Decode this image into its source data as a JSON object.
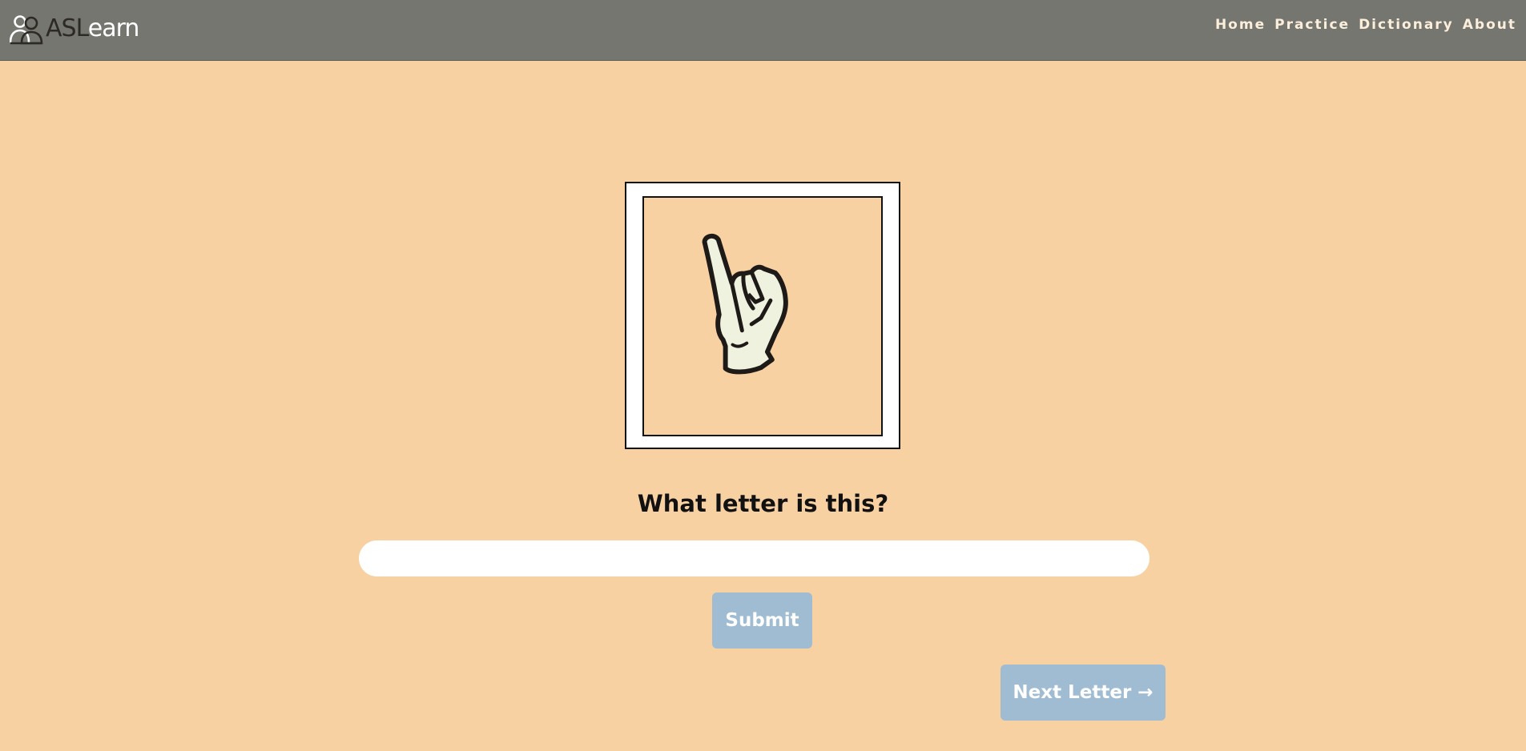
{
  "brand": {
    "text_a": "ASL",
    "text_b": "earn",
    "icon": "people-icon"
  },
  "nav": {
    "items": [
      {
        "label": "Home"
      },
      {
        "label": "Practice"
      },
      {
        "label": "Dictionary"
      },
      {
        "label": "About"
      }
    ]
  },
  "quiz": {
    "sign_image": "asl-hand-sign-i-icon",
    "question": "What letter is this?",
    "answer_value": "",
    "submit_label": "Submit",
    "next_label": "Next Letter →"
  },
  "colors": {
    "background": "#f8d1a3",
    "navbar": "#767671",
    "button": "#9fbcd2",
    "nav_text": "#fbefdc"
  }
}
